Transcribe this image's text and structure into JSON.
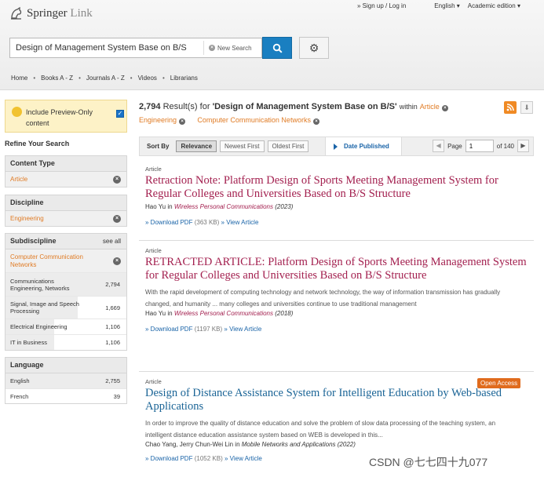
{
  "header": {
    "logo_text": "Springer",
    "logo_sub": "Link",
    "sign_up": "» Sign up / Log in",
    "language": "English",
    "edition": "Academic edition",
    "search_value": "Design of Management System Base on B/S",
    "new_search": "New Search",
    "nav": [
      "Home",
      "Books A - Z",
      "Journals A - Z",
      "Videos",
      "Librarians"
    ]
  },
  "sidebar": {
    "preview_label": "Include Preview-Only content",
    "refine": "Refine Your Search",
    "content_type": {
      "title": "Content Type",
      "selected": "Article"
    },
    "discipline": {
      "title": "Discipline",
      "selected": "Engineering"
    },
    "subdiscipline": {
      "title": "Subdiscipline",
      "see_all": "see all",
      "selected": "Computer Communication Networks",
      "items": [
        {
          "label": "Communications Engineering, Networks",
          "count": "2,794",
          "fill": 1.0
        },
        {
          "label": "Signal, Image and Speech Processing",
          "count": "1,669",
          "fill": 0.6
        },
        {
          "label": "Electrical Engineering",
          "count": "1,106",
          "fill": 0.4
        },
        {
          "label": "IT in Business",
          "count": "1,106",
          "fill": 0.4
        }
      ]
    },
    "language": {
      "title": "Language",
      "items": [
        {
          "label": "English",
          "count": "2,755"
        },
        {
          "label": "French",
          "count": "39"
        }
      ]
    }
  },
  "results": {
    "count": "2,794",
    "result_word": "Result(s) for",
    "query": "'Design of Management System Base on B/S'",
    "within": "within",
    "filter1": "Article",
    "filter2": "Engineering",
    "filter3": "Computer Communication Networks",
    "sort_by": "Sort By",
    "sort_options": [
      "Relevance",
      "Newest First",
      "Oldest First"
    ],
    "date_published": "Date Published",
    "page_label": "Page",
    "page_value": "1",
    "page_of": "of 140",
    "items": [
      {
        "type": "Article",
        "title": "Retraction Note: Platform Design of Sports Meeting Management System for Regular Colleges and Universities Based on B/S Structure",
        "author": "Hao Yu",
        "in": "in",
        "journal": "Wireless Personal Communications",
        "year": "(2023)",
        "download": "» Download PDF",
        "size": "(363 KB)",
        "view": "» View Article"
      },
      {
        "type": "Article",
        "title": "RETRACTED ARTICLE: Platform Design of Sports Meeting Management System for Regular Colleges and Universities Based on B/S Structure",
        "desc": "With the rapid development of computing technology and network technology, the way of information transmission has gradually changed, and humanity ... many colleges and universities continue to use traditional management",
        "author": "Hao Yu",
        "in": "in",
        "journal": "Wireless Personal Communications",
        "year": "(2018)",
        "download": "» Download PDF",
        "size": "(1197 KB)",
        "view": "» View Article"
      },
      {
        "type": "Article",
        "title": "Design of Distance Assistance System for Intelligent Education by Web-based Applications",
        "desc": "In order to improve the quality of distance education and solve the problem of slow data processing of the teaching system, an intelligent distance education assistance system based on WEB is developed in this...",
        "author": "Chao Yang, Jerry Chun-Wei Lin",
        "in": "in",
        "journal": "Mobile Networks and Applications",
        "year": "(2022)",
        "download": "» Download PDF",
        "size": "(1052 KB)",
        "view": "» View Article",
        "badge": "Open Access"
      }
    ]
  },
  "watermark": "CSDN @七七四十九077"
}
